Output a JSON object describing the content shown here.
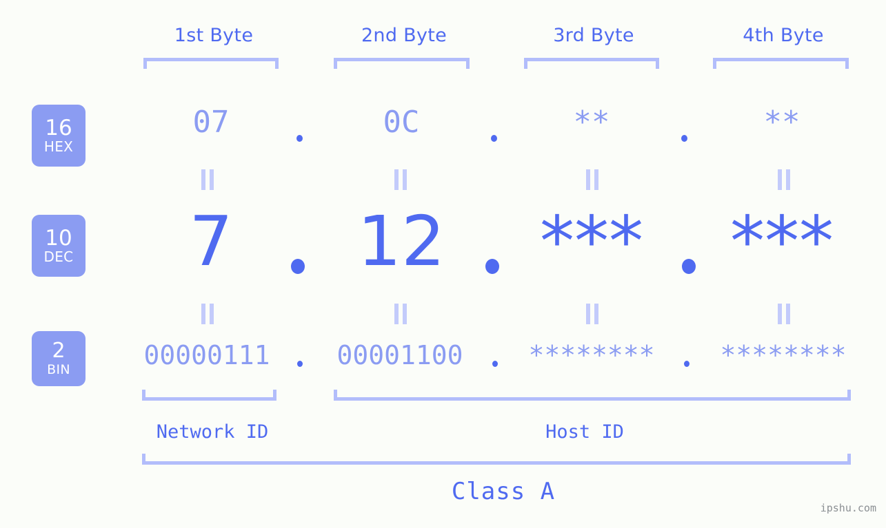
{
  "page": {
    "background_color": "#fbfdf9",
    "accent_strong": "#4f6af0",
    "accent_light": "#8b9cf2",
    "accent_pale": "#b2bdfb",
    "watermark": "ipshu.com"
  },
  "byte_headers": [
    {
      "label": "1st Byte"
    },
    {
      "label": "2nd Byte"
    },
    {
      "label": "3rd Byte"
    },
    {
      "label": "4th Byte"
    }
  ],
  "radix_badges": [
    {
      "number": "16",
      "name": "HEX"
    },
    {
      "number": "10",
      "name": "DEC"
    },
    {
      "number": "2",
      "name": "BIN"
    }
  ],
  "rows": {
    "hex": {
      "radix_number": "16",
      "radix_name": "HEX",
      "values": [
        "07",
        "0C",
        "**",
        "**"
      ],
      "separator": "."
    },
    "dec": {
      "radix_number": "10",
      "radix_name": "DEC",
      "values": [
        "7",
        "12",
        "***",
        "***"
      ],
      "separator": "."
    },
    "bin": {
      "radix_number": "2",
      "radix_name": "BIN",
      "values": [
        "00000111",
        "00001100",
        "********",
        "********"
      ],
      "separator": "."
    }
  },
  "equals_marks": {
    "symbol": "=",
    "count_per_row": 4
  },
  "id_sections": [
    {
      "label": "Network ID"
    },
    {
      "label": "Host ID"
    }
  ],
  "class_section": {
    "label": "Class A"
  }
}
